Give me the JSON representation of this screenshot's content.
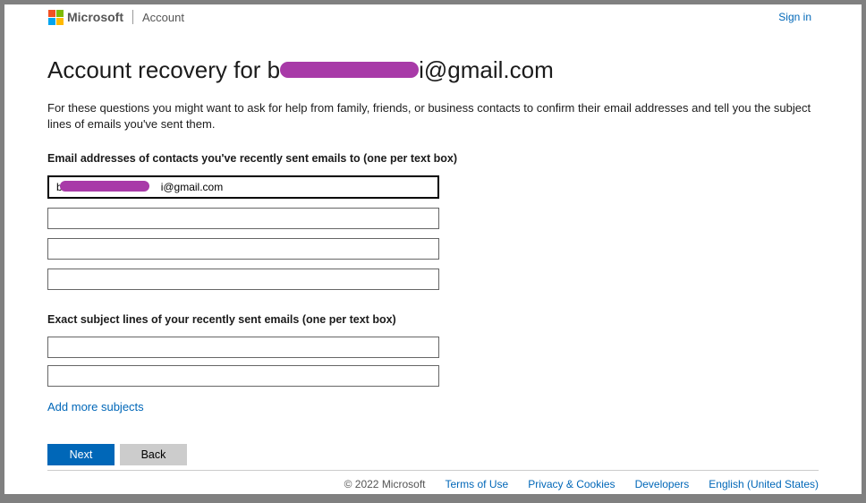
{
  "header": {
    "brand": "Microsoft",
    "section": "Account",
    "signin": "Sign in"
  },
  "page": {
    "title_prefix": "Account recovery for b",
    "title_suffix": "i@gmail.com",
    "intro": "For these questions you might want to ask for help from family, friends, or business contacts to confirm their email addresses and tell you the subject lines of emails you've sent them.",
    "contacts_label": "Email addresses of contacts you've recently sent emails to (one per text box)",
    "contact_inputs": {
      "field1_prefix": "b",
      "field1_suffix": "i@gmail.com",
      "field2": "",
      "field3": "",
      "field4": ""
    },
    "subjects_label": "Exact subject lines of your recently sent emails (one per text box)",
    "subject_inputs": {
      "field1": "",
      "field2": ""
    },
    "add_more": "Add more subjects",
    "next": "Next",
    "back": "Back"
  },
  "footer": {
    "copyright": "© 2022 Microsoft",
    "terms": "Terms of Use",
    "privacy": "Privacy & Cookies",
    "developers": "Developers",
    "language": "English (United States)"
  }
}
